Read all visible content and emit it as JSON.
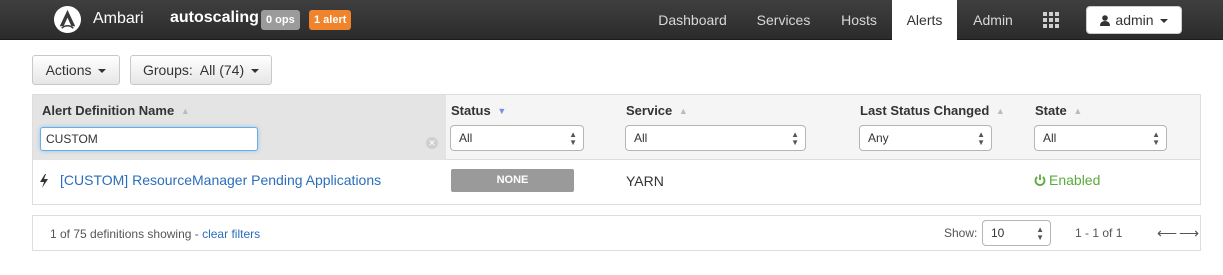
{
  "topbar": {
    "brand": "Ambari",
    "cluster_name": "autoscaling",
    "ops_badge": "0 ops",
    "alert_badge": "1 alert",
    "nav": [
      "Dashboard",
      "Services",
      "Hosts",
      "Alerts",
      "Admin"
    ],
    "active_nav": "Alerts",
    "user": "admin"
  },
  "toolbar": {
    "actions_label": "Actions",
    "groups_label": "Groups:  All (74)"
  },
  "table": {
    "columns": {
      "name": "Alert Definition Name",
      "status": "Status",
      "service": "Service",
      "last_changed": "Last Status Changed",
      "state": "State"
    },
    "filters": {
      "name": "CUSTOM",
      "status": "All",
      "service": "All",
      "last_changed": "Any",
      "state": "All"
    },
    "rows": [
      {
        "name": "[CUSTOM] ResourceManager Pending Applications",
        "status": "NONE",
        "service": "YARN",
        "last_changed": "",
        "state": "Enabled"
      }
    ]
  },
  "footer": {
    "summary": "1 of 75 definitions showing - ",
    "clear_filters": "clear filters",
    "show_label": "Show:",
    "page_size": "10",
    "page_info": "1 - 1 of 1"
  },
  "colors": {
    "topbar": "#333333",
    "alert_badge": "#f0842c",
    "link": "#2a6ebb",
    "enabled": "#5aab3c",
    "status_none": "#9a9a9a"
  }
}
